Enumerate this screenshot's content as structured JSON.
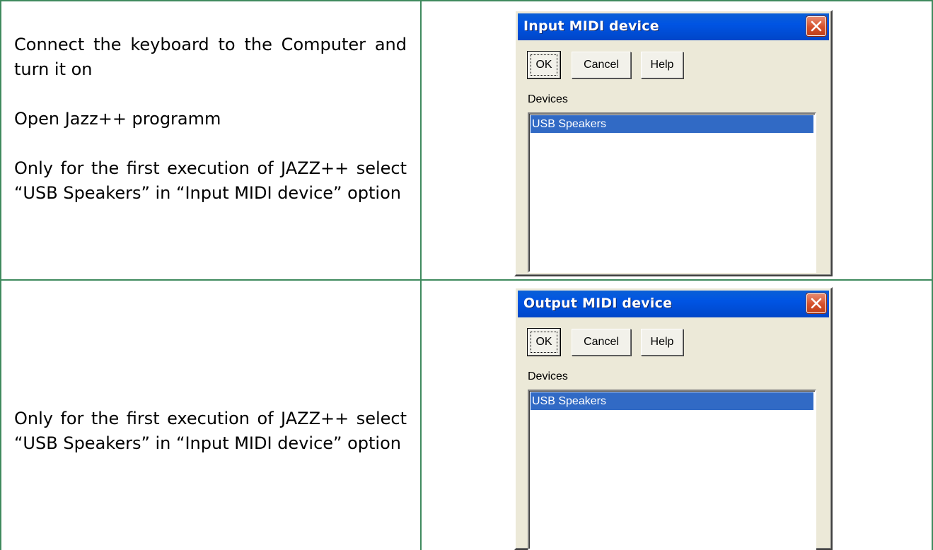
{
  "rows": [
    {
      "instructions": [
        "Connect the keyboard to the Computer and turn it on",
        "Open Jazz++ programm",
        "Only for the first execution of JAZZ++ select “USB Speakers” in “Input MIDI device” option"
      ],
      "dialog": {
        "title": "Input MIDI device",
        "ok_label": "OK",
        "cancel_label": "Cancel",
        "help_label": "Help",
        "devices_label": "Devices",
        "devices": [
          "USB Speakers"
        ],
        "selected_device": "USB Speakers"
      }
    },
    {
      "instructions": [
        "Only for the first execution of JAZZ++ select “USB Speakers” in “Input MIDI device” option"
      ],
      "dialog": {
        "title": "Output MIDI device",
        "ok_label": "OK",
        "cancel_label": "Cancel",
        "help_label": "Help",
        "devices_label": "Devices",
        "devices": [
          "USB Speakers"
        ],
        "selected_device": "USB Speakers"
      }
    }
  ],
  "colors": {
    "table_border": "#3f8a5e",
    "titlebar": "#0054e3",
    "selection": "#316ac5",
    "dialog_face": "#ece9d8"
  }
}
